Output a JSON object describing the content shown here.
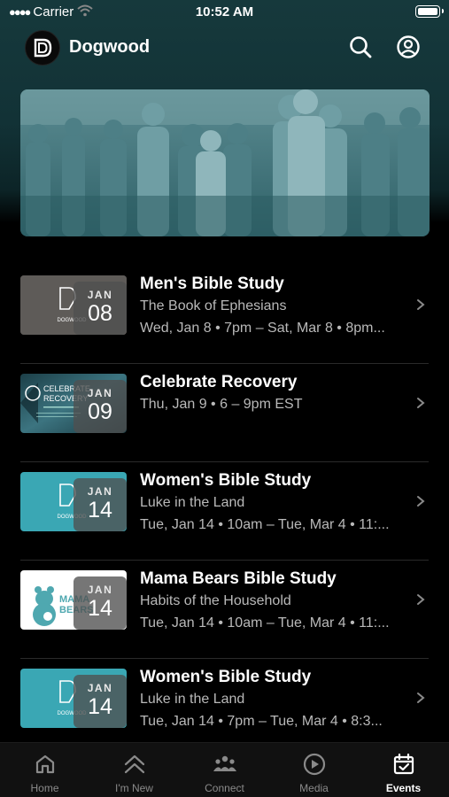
{
  "status": {
    "carrier": "Carrier",
    "time": "10:52 AM"
  },
  "header": {
    "title": "Dogwood",
    "search_icon": "search-icon",
    "account_icon": "account-circle-icon"
  },
  "events": [
    {
      "title": "Men's Bible Study",
      "subtitle": "The Book of Ephesians",
      "time": "Wed, Jan 8 • 7pm – Sat, Mar 8 • 8pm...",
      "month": "JAN",
      "day": "08",
      "thumb_color": "#5c5a58"
    },
    {
      "title": "Celebrate Recovery",
      "subtitle": "",
      "time": "Thu, Jan 9 • 6 – 9pm EST",
      "month": "JAN",
      "day": "09",
      "thumb_color": "#2f5f6a"
    },
    {
      "title": "Women's Bible Study",
      "subtitle": "Luke in the Land",
      "time": "Tue, Jan 14 • 10am – Tue, Mar 4 • 11:...",
      "month": "JAN",
      "day": "14",
      "thumb_color": "#3aa7b4"
    },
    {
      "title": "Mama Bears Bible Study",
      "subtitle": "Habits of the Household",
      "time": "Tue, Jan 14 • 10am – Tue, Mar 4 • 11:...",
      "month": "JAN",
      "day": "14",
      "thumb_color": "#ffffff"
    },
    {
      "title": "Women's Bible Study",
      "subtitle": "Luke in the Land",
      "time": "Tue, Jan 14 • 7pm – Tue, Mar 4 • 8:3...",
      "month": "JAN",
      "day": "14",
      "thumb_color": "#3aa7b4"
    }
  ],
  "thumb_text": {
    "dogwood": "DOGWOOD",
    "celebrate": "CELEBRATE",
    "recovery": "RECOVERY",
    "mama": "MAMA",
    "bears": "BEARS"
  },
  "tabs": [
    {
      "label": "Home",
      "icon": "home-icon"
    },
    {
      "label": "I'm New",
      "icon": "chevrons-up-icon"
    },
    {
      "label": "Connect",
      "icon": "people-icon"
    },
    {
      "label": "Media",
      "icon": "play-circle-icon"
    },
    {
      "label": "Events",
      "icon": "calendar-check-icon",
      "active": true
    }
  ],
  "colors": {
    "header_teal": "#16393c",
    "accent_teal": "#3aa7b4"
  }
}
